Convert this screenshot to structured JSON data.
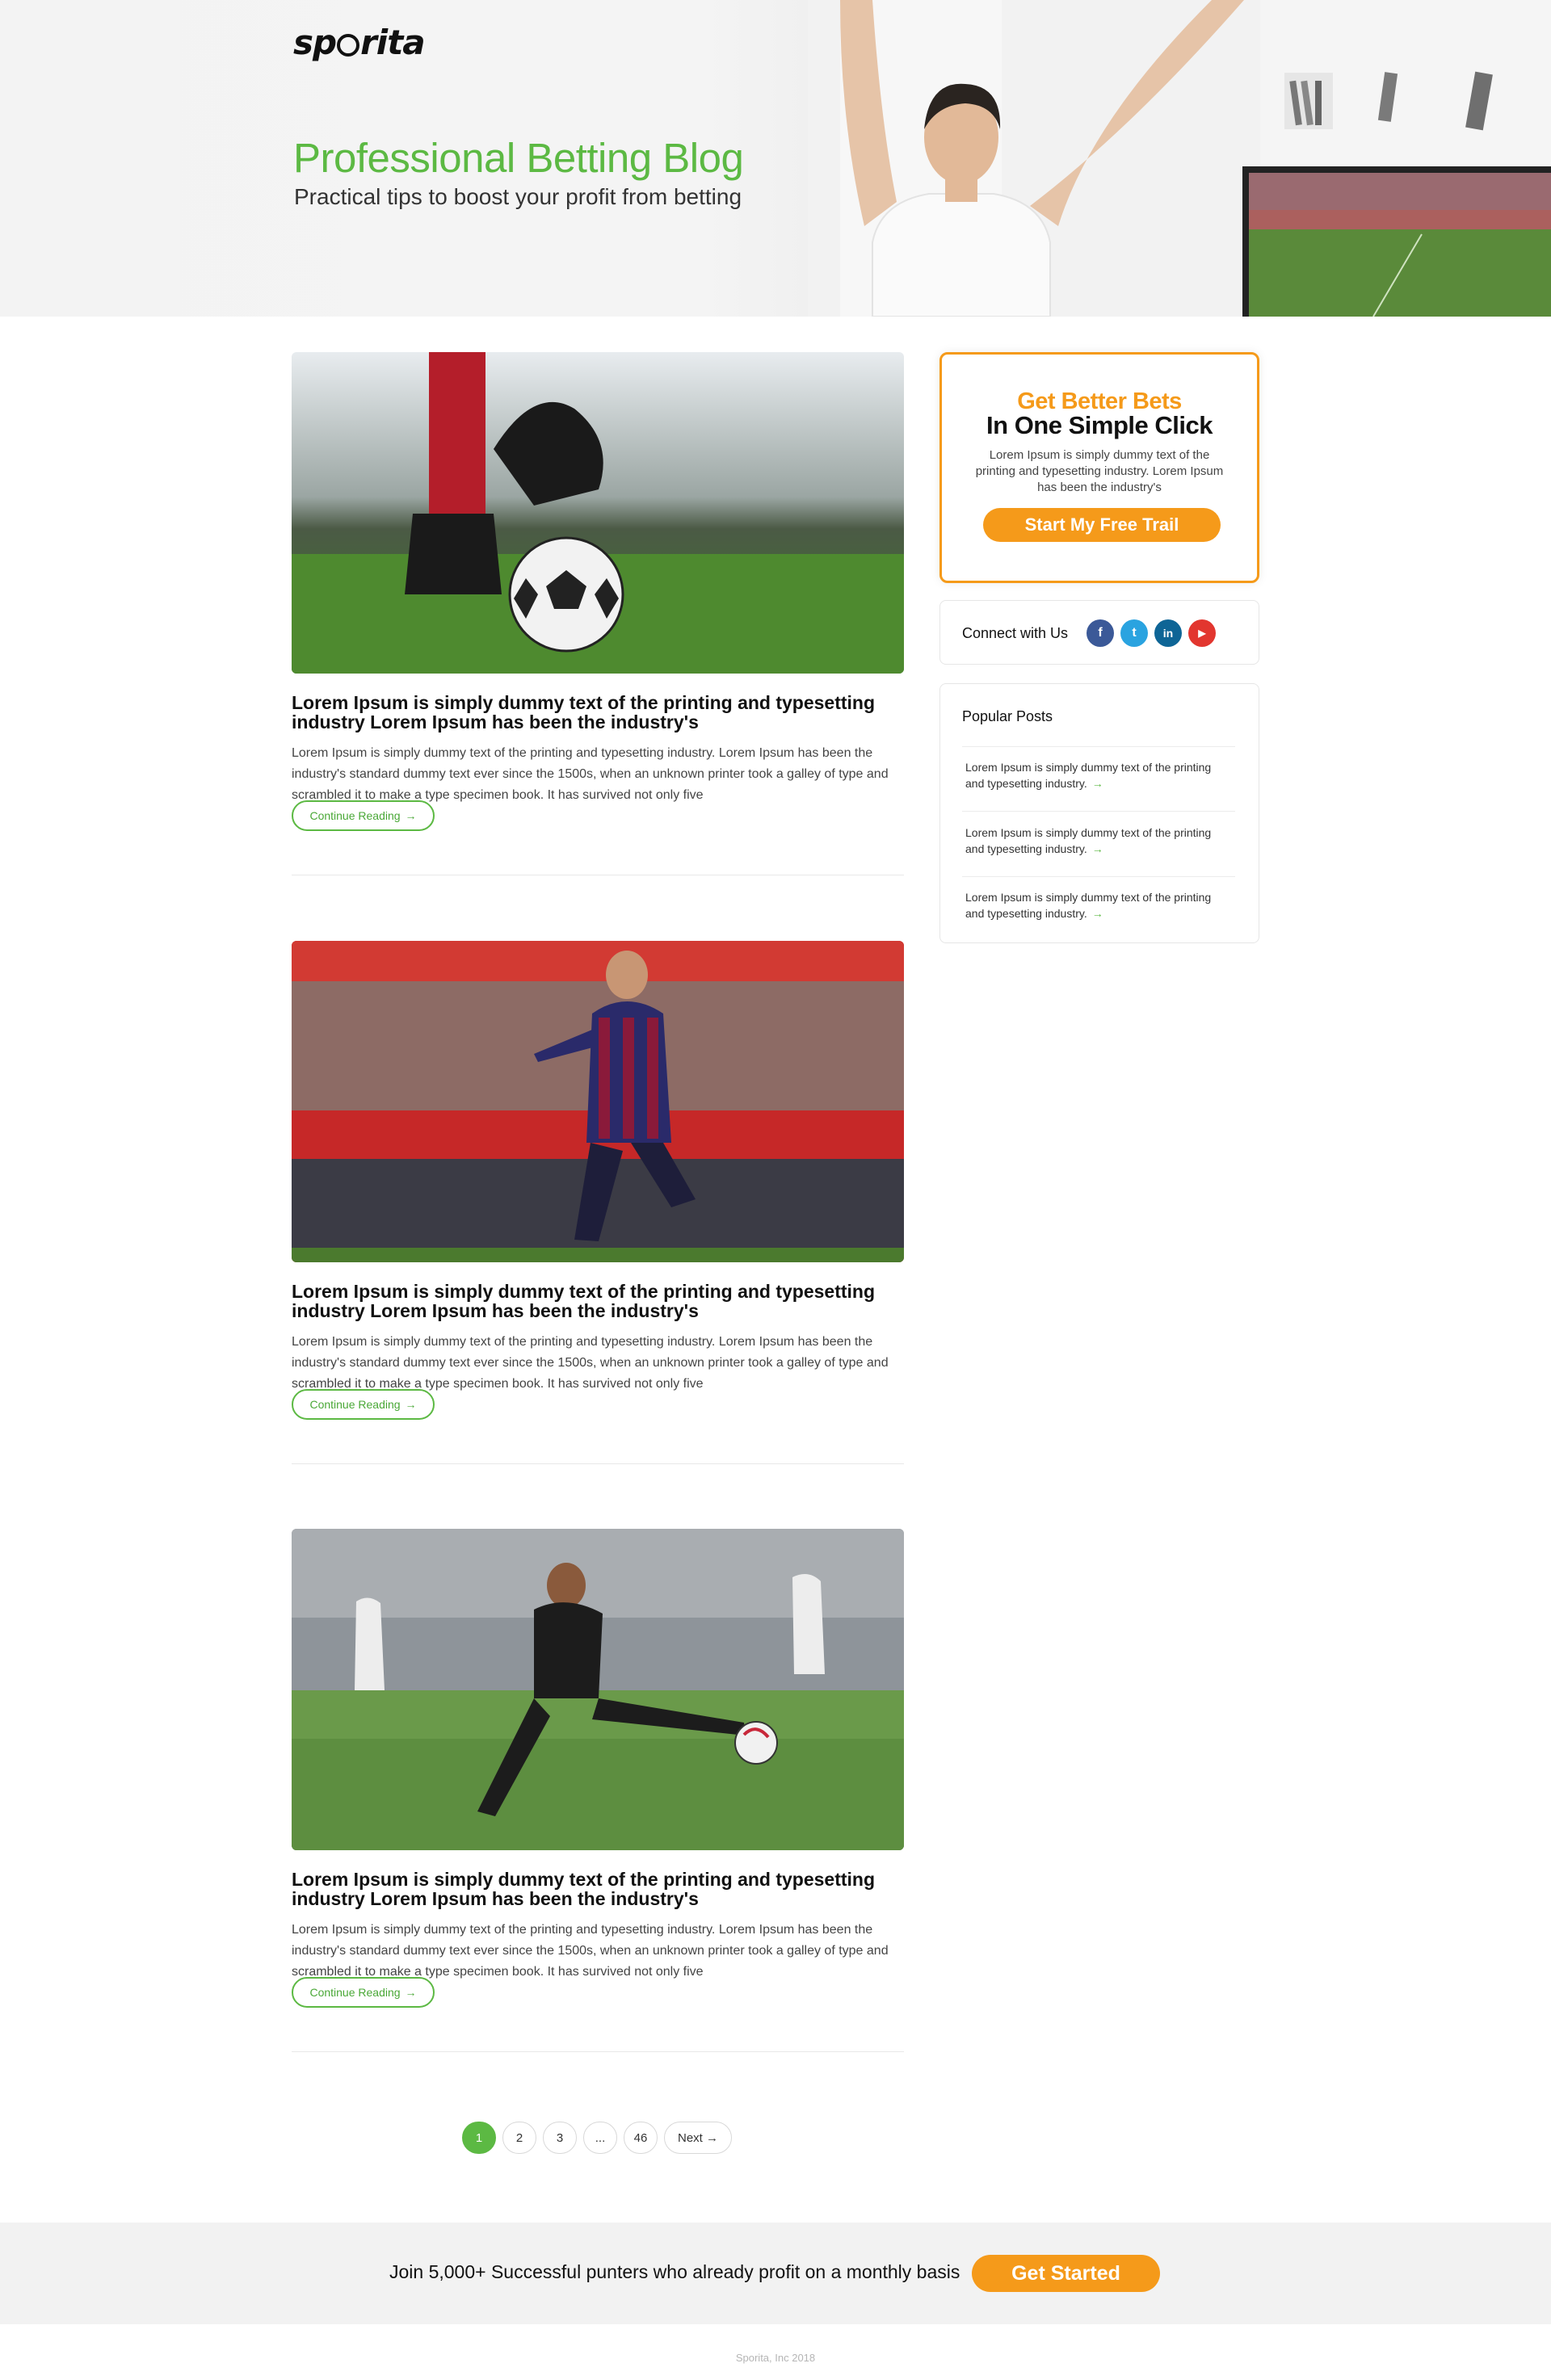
{
  "brand": {
    "logo_prefix": "sp",
    "logo_suffix": "rita",
    "logo_alt": "sporita"
  },
  "hero": {
    "title": "Professional Betting Blog",
    "subtitle": "Practical tips to boost your profit from betting"
  },
  "posts": [
    {
      "title": "Lorem Ipsum is simply dummy text of the printing and typesetting industry Lorem Ipsum has been the industry's",
      "excerpt": "Lorem Ipsum is simply dummy text of the printing and typesetting industry. Lorem Ipsum has been the industry's standard dummy text ever since the 1500s, when an unknown printer took a galley of type and scrambled it to make a type specimen book. It has survived not only five",
      "button": "Continue Reading",
      "image": "soccer-cleat-on-ball-photo"
    },
    {
      "title": "Lorem Ipsum is simply dummy text of the printing and typesetting industry Lorem Ipsum has been the industry's",
      "excerpt": "Lorem Ipsum is simply dummy text of the printing and typesetting industry. Lorem Ipsum has been the industry's standard dummy text ever since the 1500s, when an unknown printer took a galley of type and scrambled it to make a type specimen book. It has survived not only five",
      "button": "Continue Reading",
      "image": "player-celebrating-photo"
    },
    {
      "title": "Lorem Ipsum is simply dummy text of the printing and typesetting industry Lorem Ipsum has been the industry's",
      "excerpt": "Lorem Ipsum is simply dummy text of the printing and typesetting industry. Lorem Ipsum has been the industry's standard dummy text ever since the 1500s, when an unknown printer took a galley of type and scrambled it to make a type specimen book. It has survived not only five",
      "button": "Continue Reading",
      "image": "player-kicking-ball-photo"
    }
  ],
  "pagination": {
    "pages": [
      "1",
      "2",
      "3",
      "...",
      "46"
    ],
    "next": "Next",
    "current": "1"
  },
  "sidebar": {
    "promo": {
      "headline": "Get Better Bets",
      "subheadline": "In One Simple Click",
      "text": "Lorem Ipsum is simply dummy text of the printing and typesetting industry. Lorem Ipsum has been the industry's",
      "button": "Start My Free Trail"
    },
    "connect": {
      "label": "Connect with Us",
      "networks": [
        {
          "name": "facebook-icon",
          "glyph": "f",
          "color": "#3b5998"
        },
        {
          "name": "twitter-icon",
          "glyph": "t",
          "color": "#2aa3e0"
        },
        {
          "name": "linkedin-icon",
          "glyph": "in",
          "color": "#0e6596"
        },
        {
          "name": "youtube-icon",
          "glyph": "▶",
          "color": "#e2362f"
        }
      ]
    },
    "popular": {
      "title": "Popular Posts",
      "items": [
        "Lorem Ipsum is simply dummy text of the printing and typesetting industry.",
        "Lorem Ipsum is simply dummy text of the printing and typesetting industry.",
        "Lorem Ipsum is simply dummy text of the printing and typesetting industry."
      ]
    }
  },
  "cta": {
    "text": "Join 5,000+ Successful punters who already profit on a monthly basis",
    "button": "Get Started"
  },
  "footer": {
    "copyright": "Sporita, Inc 2018"
  },
  "colors": {
    "accent_green": "#5cb943",
    "accent_orange": "#f59a1a"
  }
}
